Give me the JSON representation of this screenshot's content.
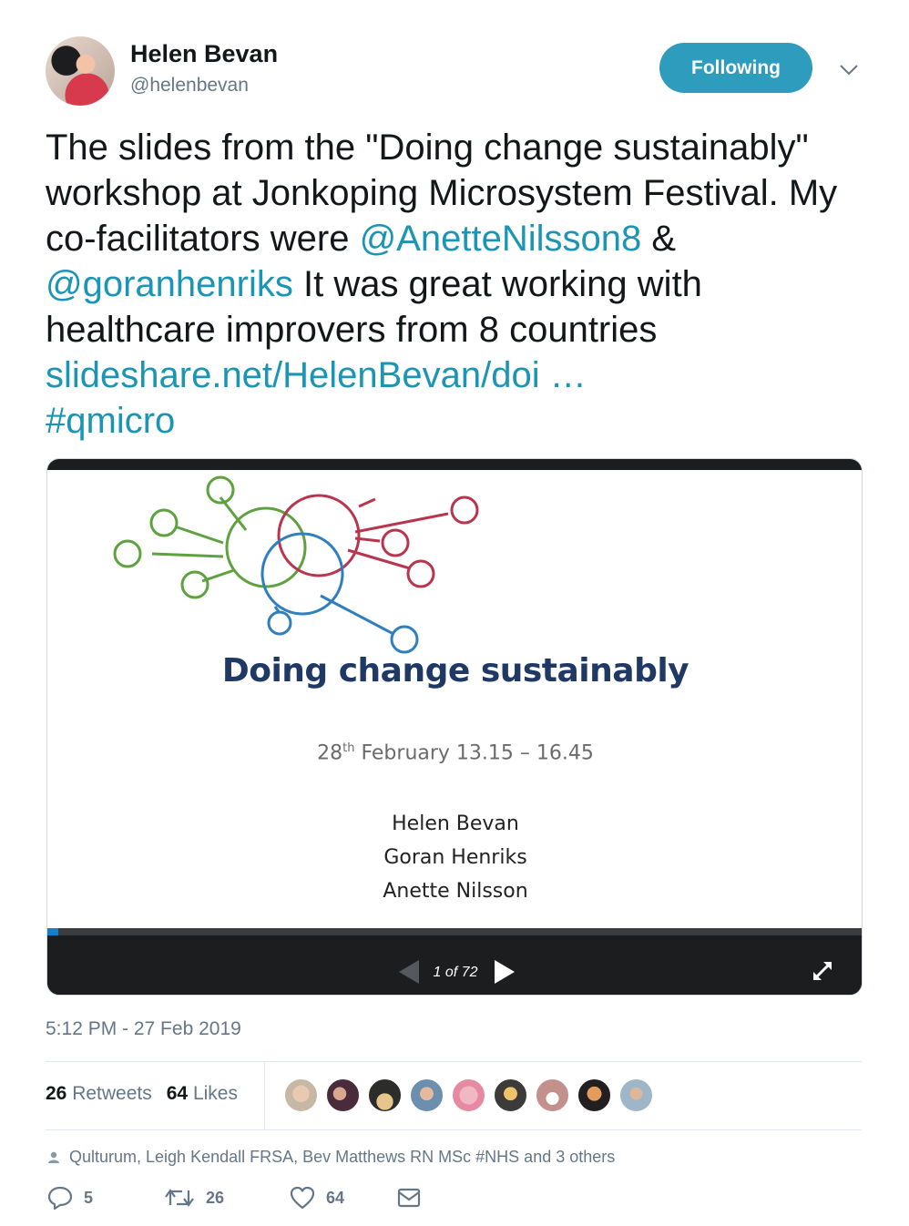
{
  "author": {
    "name": "Helen Bevan",
    "handle": "@helenbevan",
    "avatar_icon": "profile-photo"
  },
  "follow_button": {
    "label": "Following",
    "color": "#2d9cbd"
  },
  "tweet": {
    "text_part1": "The slides from the \"Doing change sustainably\" workshop at Jonkoping Microsystem Festival. My co-facilitators were ",
    "mention1": "@AnetteNilsson8",
    "text_part2": " & ",
    "mention2": "@goranhenriks",
    "text_part3": " It was great working with healthcare improvers from 8 countries ",
    "link": "slideshare.net/HelenBevan/doi …",
    "text_part4": " ",
    "hashtag": "#qmicro",
    "link_color": "#1b95b5"
  },
  "slide_card": {
    "title": "Doing change sustainably",
    "date_day": "28",
    "date_suffix": "th",
    "date_rest": " February 13.15 – 16.45",
    "names": [
      "Helen Bevan",
      "Goran Henriks",
      "Anette Nilsson"
    ],
    "page_indicator": "1 of 72",
    "current_page": 1,
    "total_pages": 72
  },
  "timestamp": "5:12 PM - 27 Feb 2019",
  "stats": {
    "retweets_count": "26",
    "retweets_label": "Retweets",
    "likes_count": "64",
    "likes_label": "Likes"
  },
  "liked_by": "Qulturum, Leigh Kendall FRSA, Bev Matthews RN MSc #NHS and 3 others",
  "actions": {
    "reply_count": "5",
    "retweet_count": "26",
    "like_count": "64"
  }
}
